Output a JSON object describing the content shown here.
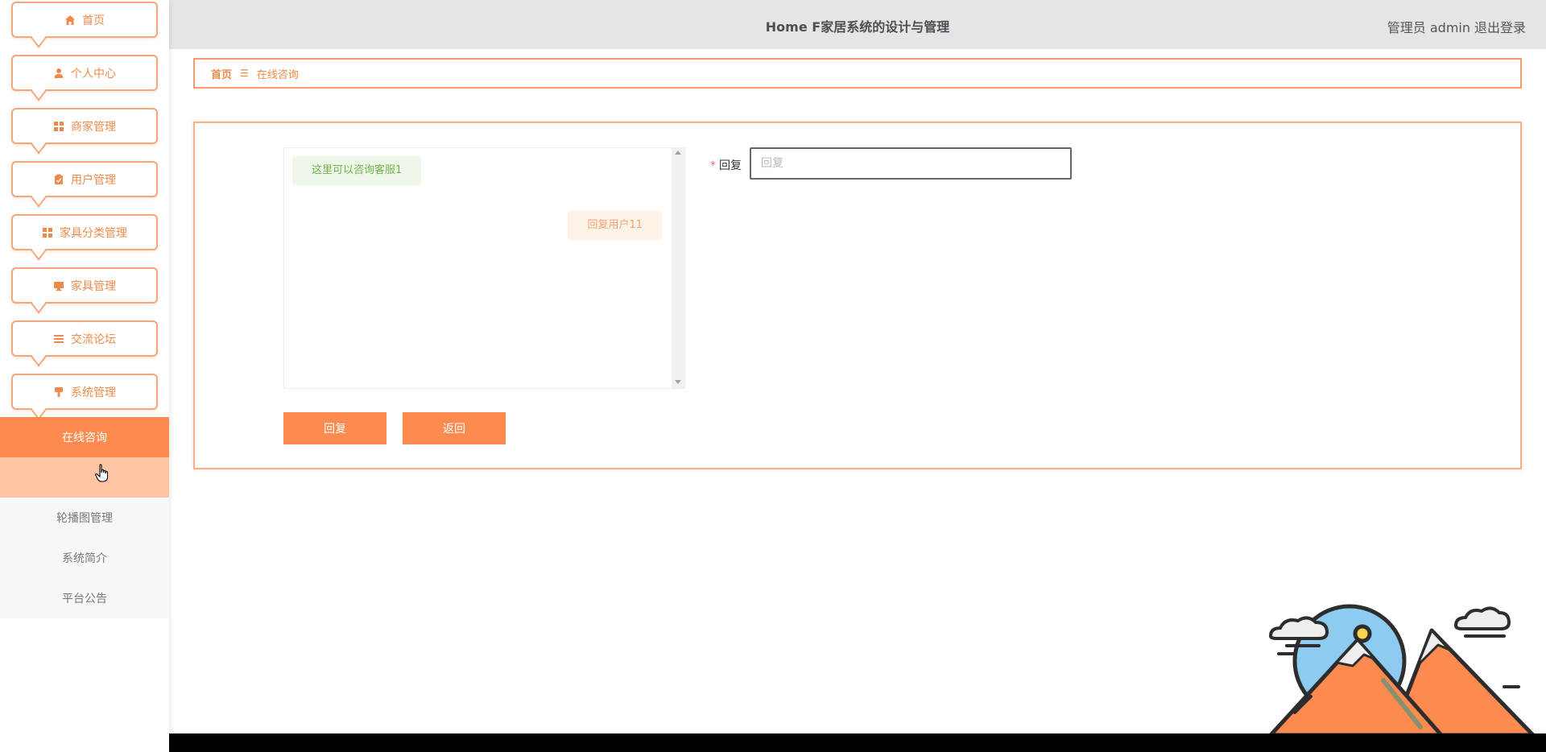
{
  "header": {
    "title": "Home F家居系统的设计与管理",
    "user": "管理员 admin",
    "logout": "退出登录"
  },
  "sidebar": {
    "items": [
      {
        "label": "首页",
        "icon": "home-icon"
      },
      {
        "label": "个人中心",
        "icon": "user-icon"
      },
      {
        "label": "商家管理",
        "icon": "grid-icon"
      },
      {
        "label": "用户管理",
        "icon": "clipboard-icon"
      },
      {
        "label": "家具分类管理",
        "icon": "grid-icon"
      },
      {
        "label": "家具管理",
        "icon": "monitor-icon"
      },
      {
        "label": "交流论坛",
        "icon": "list-icon"
      },
      {
        "label": "系统管理",
        "icon": "brush-icon"
      }
    ],
    "sub_items": [
      {
        "label": "在线咨询",
        "state": "active"
      },
      {
        "label": "",
        "state": "hover"
      },
      {
        "label": "轮播图管理",
        "state": "normal"
      },
      {
        "label": "系统简介",
        "state": "normal"
      },
      {
        "label": "平台公告",
        "state": "normal"
      }
    ]
  },
  "breadcrumb": {
    "home": "首页",
    "separator": "☰",
    "current": "在线咨询"
  },
  "chat": {
    "messages": [
      {
        "side": "left",
        "text": "这里可以咨询客服1"
      },
      {
        "side": "right",
        "text": "回复用户11"
      }
    ]
  },
  "form": {
    "reply_label": "回复",
    "required_mark": "*",
    "reply_placeholder": "回复",
    "reply_value": ""
  },
  "buttons": {
    "reply": "回复",
    "back": "返回"
  },
  "colors": {
    "accent": "#fd8b4f",
    "border": "#f39a66",
    "header_bg": "#e6e5e5"
  }
}
